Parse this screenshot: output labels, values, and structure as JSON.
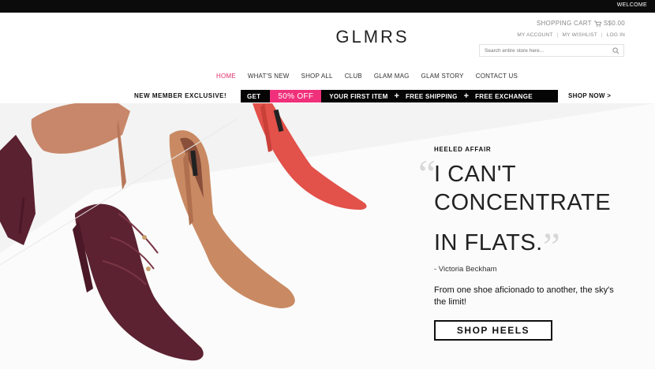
{
  "topbar": {
    "welcome": "WELCOME"
  },
  "header": {
    "logo": "GLMRS",
    "cart_label": "SHOPPING CART",
    "cart_total": "S$0.00",
    "account_links": [
      "MY ACCOUNT",
      "MY WISHLIST",
      "LOG IN"
    ],
    "search_placeholder": "Search entire store here..."
  },
  "nav": {
    "items": [
      "HOME",
      "WHAT'S NEW",
      "SHOP ALL",
      "CLUB",
      "GLAM MAG",
      "GLAM STORY",
      "CONTACT US"
    ],
    "active": "HOME"
  },
  "promo": {
    "lead": "NEW MEMBER EXCLUSIVE!",
    "get": "GET",
    "discount": "50% OFF",
    "first_item": "YOUR FIRST ITEM",
    "plus": "+",
    "free_shipping": "FREE SHIPPING",
    "free_exchange": "FREE EXCHANGE",
    "shop_now": "SHOP NOW >"
  },
  "hero": {
    "kicker": "HEELED AFFAIR",
    "headline_lines": [
      "I CAN'T",
      "CONCENTRATE",
      "IN FLATS."
    ],
    "attribution": "- Victoria Beckham",
    "tagline": "From one shoe aficionado to another, the sky's the limit!",
    "cta": "SHOP HEELS"
  },
  "colors": {
    "accent": "#f0307a",
    "nav_active": "#e0306d",
    "suede_tan": "#c98a63",
    "burgundy": "#5c2231",
    "red_pump": "#e2514a"
  }
}
